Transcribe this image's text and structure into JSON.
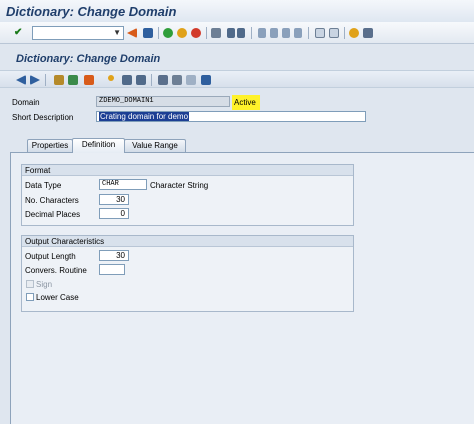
{
  "window": {
    "title": "Dictionary: Change Domain"
  },
  "system_toolbar": {
    "icons": [
      "enter-icon",
      "command-field",
      "save-icon",
      "back-icon",
      "exit-icon",
      "cancel-icon",
      "print-icon",
      "find-icon",
      "find-next-icon",
      "first-page-icon",
      "previous-page-icon",
      "next-page-icon",
      "last-page-icon",
      "new-session-icon",
      "shortcut-icon",
      "help-icon",
      "customize-layout-icon"
    ]
  },
  "screen": {
    "title": "Dictionary: Change Domain",
    "app_toolbar_icons": [
      "back-arrow-icon",
      "forward-arrow-icon",
      "display-change-icon",
      "other-object-icon",
      "activate-icon",
      "where-used-icon",
      "object-list-icon",
      "hierarchy-icon",
      "info-icon"
    ]
  },
  "header": {
    "domain_label": "Domain",
    "domain_value": "ZDEMO_DOMAIN1",
    "status": "Active",
    "short_desc_label": "Short Description",
    "short_desc_value": "Crating domain for demo"
  },
  "tabs": [
    {
      "label": "Properties",
      "active": false
    },
    {
      "label": "Definition",
      "active": true
    },
    {
      "label": "Value Range",
      "active": false
    }
  ],
  "format": {
    "title": "Format",
    "data_type_label": "Data Type",
    "data_type_value": "CHAR",
    "data_type_desc": "Character String",
    "no_chars_label": "No. Characters",
    "no_chars_value": "30",
    "decimals_label": "Decimal Places",
    "decimals_value": "0"
  },
  "output": {
    "title": "Output Characteristics",
    "output_length_label": "Output Length",
    "output_length_value": "30",
    "conv_routine_label": "Convers. Routine",
    "conv_routine_value": "",
    "sign_label": "Sign",
    "sign_checked": false,
    "lowercase_label": "Lower Case",
    "lowercase_checked": false
  },
  "colors": {
    "title": "#1f3e6b",
    "status_highlight": "#fff22a",
    "selection": "#1c3f94"
  }
}
